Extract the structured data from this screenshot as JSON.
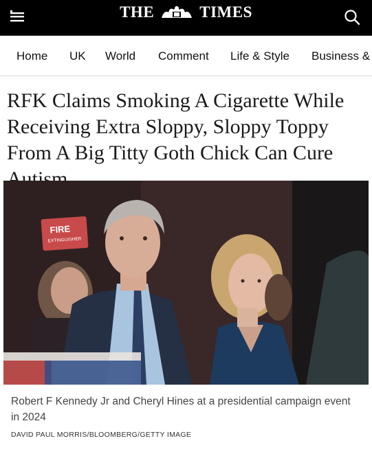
{
  "header": {
    "brand_left": "THE",
    "brand_right": "TIMES",
    "menu_icon": "hamburger-menu-icon",
    "search_icon": "search-icon"
  },
  "nav": {
    "items": [
      "Home",
      "UK",
      "World",
      "Comment",
      "Life & Style",
      "Business &"
    ]
  },
  "article": {
    "headline": "RFK Claims Smoking A Cigarette While Receiving Extra Sloppy, Sloppy Toppy From A Big Titty Goth Chick Can Cure Autism",
    "photo": {
      "sign_text": "FIRE",
      "sign_subtext": "EXTINGUISHER"
    },
    "caption": "Robert F Kennedy Jr and Cheryl Hines at a presidential campaign event in 2024",
    "credit": "DAVID PAUL MORRIS/BLOOMBERG/GETTY IMAGE"
  },
  "colors": {
    "topbar": "#000000",
    "text": "#111111",
    "caption": "#444444"
  }
}
